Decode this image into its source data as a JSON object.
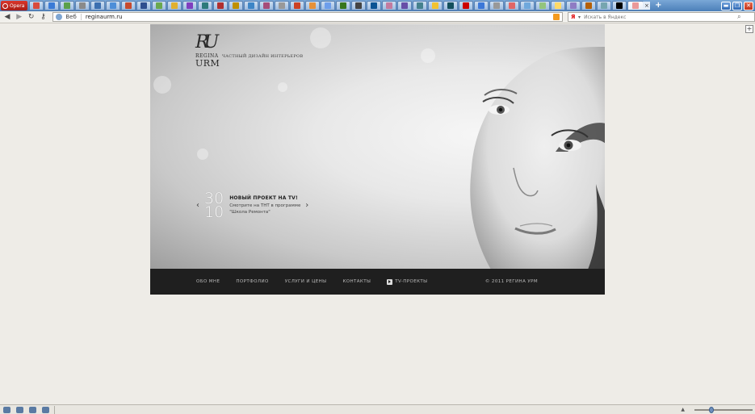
{
  "browser": {
    "menu_label": "Opera",
    "tab_favicon_colors": [
      "#d94b3d",
      "#3b7bd6",
      "#5aa04a",
      "#8a8a8a",
      "#3b6fb0",
      "#4d8ed8",
      "#c64a2e",
      "#2f4f8f",
      "#6aa84f",
      "#e0b030",
      "#7f3fbf",
      "#2c7a7b",
      "#b03030",
      "#bf9000",
      "#3d85c6",
      "#a64d79",
      "#999999",
      "#cc4125",
      "#e69138",
      "#6d9eeb",
      "#38761d",
      "#444444",
      "#0b5394",
      "#c27ba0",
      "#674ea7",
      "#45818e",
      "#f1c232",
      "#134f5c",
      "#cc0000",
      "#3c78d8",
      "#999999",
      "#e06666",
      "#6fa8dc",
      "#93c47d",
      "#ffd966",
      "#8e7cc3",
      "#b45f06",
      "#76a5af",
      "#000000",
      "#a61c00",
      "#274e13",
      "#666666",
      "#0c343d",
      "#20124d",
      "#d5a6bd",
      "#ea9999"
    ],
    "active_tab_close": "×",
    "new_tab": "+",
    "window_controls": [
      "▬",
      "❐",
      "✕"
    ]
  },
  "address_bar": {
    "back_icon": "arrow-left-icon",
    "forward_icon": "arrow-right-icon",
    "reload_icon": "reload-icon",
    "key_icon": "key-icon",
    "web_label": "Веб",
    "url": "reginaurm.ru",
    "search_placeholder": "Искать в Яндекс"
  },
  "site": {
    "logo_monogram": "RU",
    "logo_regina": "REGINA",
    "logo_urm": "URM",
    "tagline": "ЧАСТНЫЙ ДИЗАЙН ИНТЕРЬЕРОВ",
    "promo": {
      "day": "30",
      "month": "10",
      "title": "НОВЫЙ ПРОЕКТ НА TV!",
      "body_line1": "Смотрите на ТНТ в программе",
      "body_line2": "\"Школа Ремонта\"",
      "prev": "‹",
      "next": "›"
    },
    "footer": {
      "menu": [
        "ОБО МНЕ",
        "ПОРТФОЛИО",
        "УСЛУГИ И ЦЕНЫ",
        "КОНТАКТЫ"
      ],
      "tv_link": "TV-ПРОЕКТЫ",
      "copyright": "© 2011 РЕГИНА УРМ"
    }
  },
  "panel_toggle": "+"
}
